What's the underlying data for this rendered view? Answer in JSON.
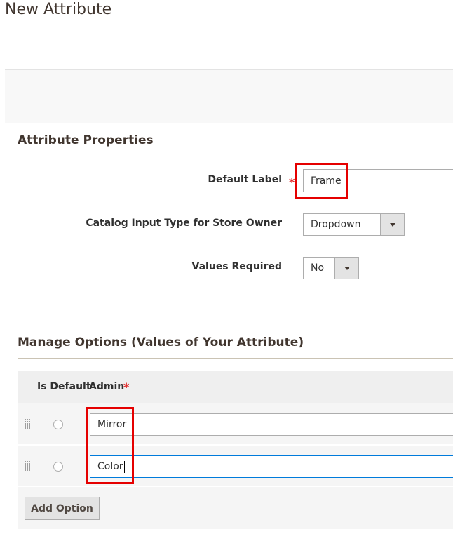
{
  "page": {
    "title": "New Attribute"
  },
  "properties": {
    "section_title": "Attribute Properties",
    "default_label": {
      "label": "Default Label",
      "required": "*",
      "value": "Frame"
    },
    "input_type": {
      "label": "Catalog Input Type for Store Owner",
      "value": "Dropdown",
      "icon": "chevron-down-icon"
    },
    "values_required": {
      "label": "Values Required",
      "value": "No",
      "icon": "chevron-down-icon"
    }
  },
  "options": {
    "section_title": "Manage Options (Values of Your Attribute)",
    "columns": {
      "is_default": "Is Default",
      "admin": "Admin",
      "admin_required": "*"
    },
    "rows": [
      {
        "value": "Mirror",
        "default": false
      },
      {
        "value": "Color",
        "default": false,
        "focused": true
      }
    ],
    "add_button": "Add Option"
  },
  "colors": {
    "highlight": "#e50000",
    "required": "#e22626",
    "focus_border": "#007bdb"
  }
}
